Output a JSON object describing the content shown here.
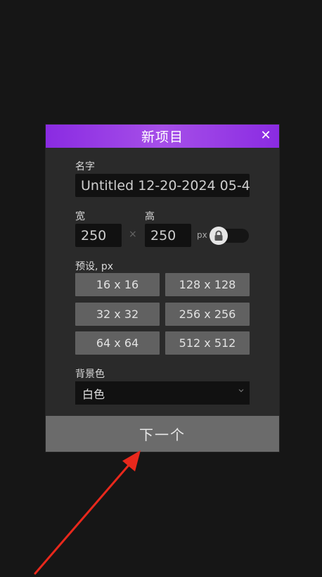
{
  "dialog": {
    "title": "新项目",
    "close_glyph": "✕",
    "name_label": "名字",
    "name_value": "Untitled 12-20-2024 05-4",
    "width_label": "宽",
    "height_label": "高",
    "width_value": "250",
    "height_value": "250",
    "times_glyph": "×",
    "unit_label": "px",
    "presets_label": "预设, px",
    "presets": [
      "16 x 16",
      "128 x 128",
      "32 x 32",
      "256 x 256",
      "64 x 64",
      "512 x 512"
    ],
    "background_label": "背景色",
    "background_value": "白色",
    "next_label": "下一个"
  },
  "icons": {
    "close": "close-icon",
    "lock": "lock-icon",
    "dropdown": "chevron-down-icon"
  },
  "colors": {
    "title_gradient_start": "#8a2be2",
    "title_gradient_mid": "#a64fe8",
    "annotation_arrow": "#e8281c"
  }
}
